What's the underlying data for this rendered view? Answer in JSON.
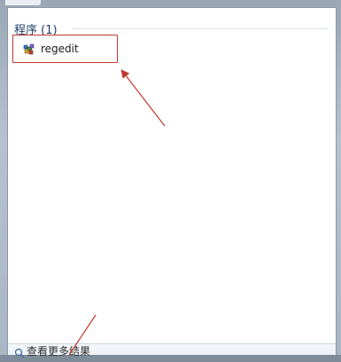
{
  "start_menu": {
    "group_header": "程序 (1)",
    "results": [
      {
        "label": "regedit",
        "icon": "registry-editor-icon"
      }
    ],
    "search_row": {
      "icon": "search-icon",
      "text": "查看更多结果"
    }
  },
  "annotations": {
    "arrow_color": "#c0382f",
    "highlight_color": "#c0382f"
  },
  "colors": {
    "header_text": "#1e3f6a",
    "panel_background": "#ffffff",
    "frame": "#a9b6c3"
  }
}
